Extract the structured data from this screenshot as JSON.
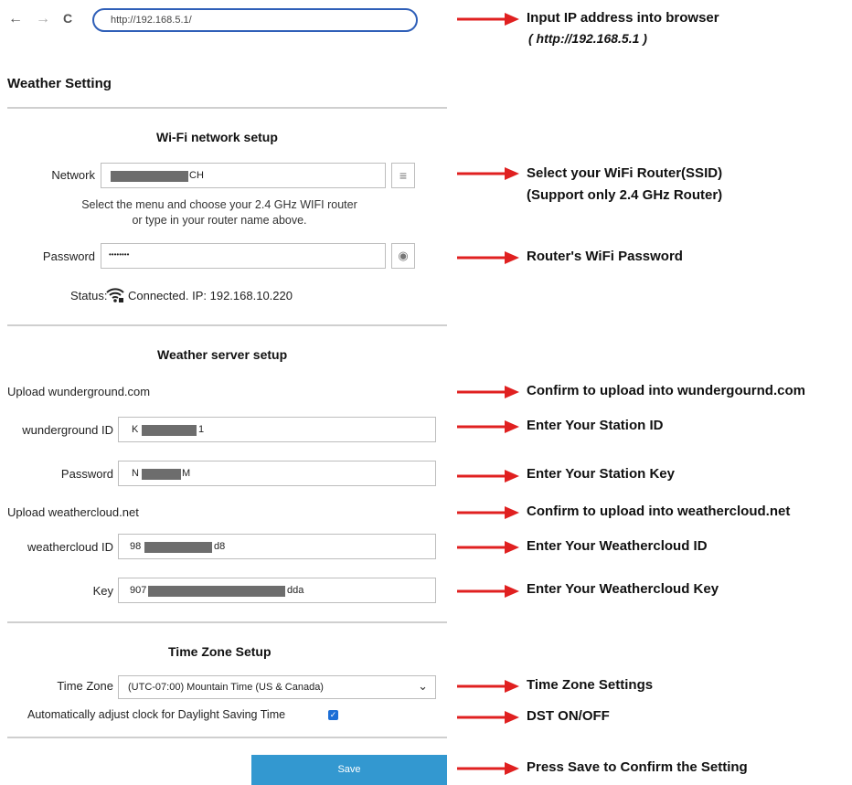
{
  "browser": {
    "back": "←",
    "forward": "→",
    "reload": "C",
    "url": "http://192.168.5.1/"
  },
  "page_title": "Weather Setting",
  "wifi": {
    "section_title": "Wi-Fi network setup",
    "network_label": "Network",
    "network_value": "CH",
    "hint_line1": "Select the menu and choose your 2.4 GHz WIFI router",
    "hint_line2": "or type in your router name above.",
    "password_label": "Password",
    "password_value": "••••••••",
    "status_label": "Status:",
    "status_text": "Connected. IP: 192.168.10.220"
  },
  "weather": {
    "section_title": "Weather server setup",
    "wu_upload_label": "Upload wunderground.com",
    "wu_id_label": "wunderground ID",
    "wu_id_prefix": "K",
    "wu_id_suffix": "1",
    "wu_password_label": "Password",
    "wu_password_prefix": "N",
    "wu_password_suffix": "M",
    "wc_upload_label": "Upload weathercloud.net",
    "wc_id_label": "weathercloud ID",
    "wc_id_prefix": "98",
    "wc_id_suffix": "d8",
    "wc_key_label": "Key",
    "wc_key_prefix": "907",
    "wc_key_suffix": "dda"
  },
  "timezone": {
    "section_title": "Time Zone Setup",
    "tz_label": "Time Zone",
    "tz_selected": "(UTC-07:00) Mountain Time (US & Canada)",
    "dst_label": "Automatically adjust clock for Daylight Saving Time",
    "dst_checked": true
  },
  "save_label": "Save",
  "annotations": {
    "url_note": "Input IP address into browser",
    "url_note_sub": "( http://192.168.5.1 )",
    "ssid_note_1": "Select your WiFi Router(SSID)",
    "ssid_note_2": "(Support only 2.4 GHz Router)",
    "password_note": "Router's WiFi Password",
    "wu_confirm_note": "Confirm to upload into wundergournd.com",
    "station_id_note": "Enter Your Station ID",
    "station_key_note": "Enter Your Station Key",
    "wc_confirm_note": "Confirm to upload into weathercloud.net",
    "wc_id_note": "Enter Your Weathercloud ID",
    "wc_key_note": "Enter Your Weathercloud Key",
    "tz_note": "Time Zone Settings",
    "dst_note": "DST ON/OFF",
    "save_note": "Press Save to Confirm the Setting"
  },
  "colors": {
    "arrow": "#e02020",
    "save_button": "#3398d0",
    "url_border": "#2f5fb8",
    "checkbox": "#1d6fd6"
  }
}
